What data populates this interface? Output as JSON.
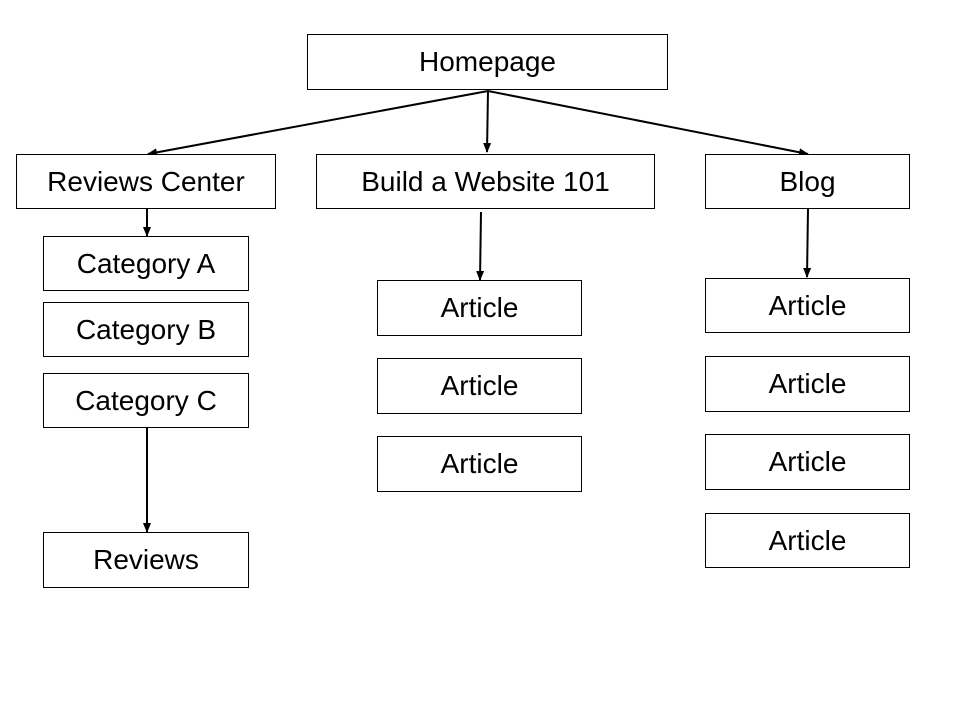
{
  "nodes": [
    {
      "id": "homepage",
      "label": "Homepage"
    },
    {
      "id": "reviews-center",
      "label": "Reviews Center"
    },
    {
      "id": "build-website",
      "label": "Build a Website 101"
    },
    {
      "id": "blog",
      "label": "Blog"
    },
    {
      "id": "category-a",
      "label": "Category A"
    },
    {
      "id": "category-b",
      "label": "Category B"
    },
    {
      "id": "category-c",
      "label": "Category C"
    },
    {
      "id": "reviews",
      "label": "Reviews"
    },
    {
      "id": "article-b1",
      "label": "Article"
    },
    {
      "id": "article-b2",
      "label": "Article"
    },
    {
      "id": "article-b3",
      "label": "Article"
    },
    {
      "id": "article-g1",
      "label": "Article"
    },
    {
      "id": "article-g2",
      "label": "Article"
    },
    {
      "id": "article-g3",
      "label": "Article"
    },
    {
      "id": "article-g4",
      "label": "Article"
    }
  ],
  "edges": [
    {
      "from": "homepage",
      "to": "reviews-center"
    },
    {
      "from": "homepage",
      "to": "build-website"
    },
    {
      "from": "homepage",
      "to": "blog"
    },
    {
      "from": "reviews-center",
      "to": "category-a"
    },
    {
      "from": "category-c",
      "to": "reviews"
    },
    {
      "from": "build-website",
      "to": "article-b1"
    },
    {
      "from": "blog",
      "to": "article-g1"
    }
  ]
}
